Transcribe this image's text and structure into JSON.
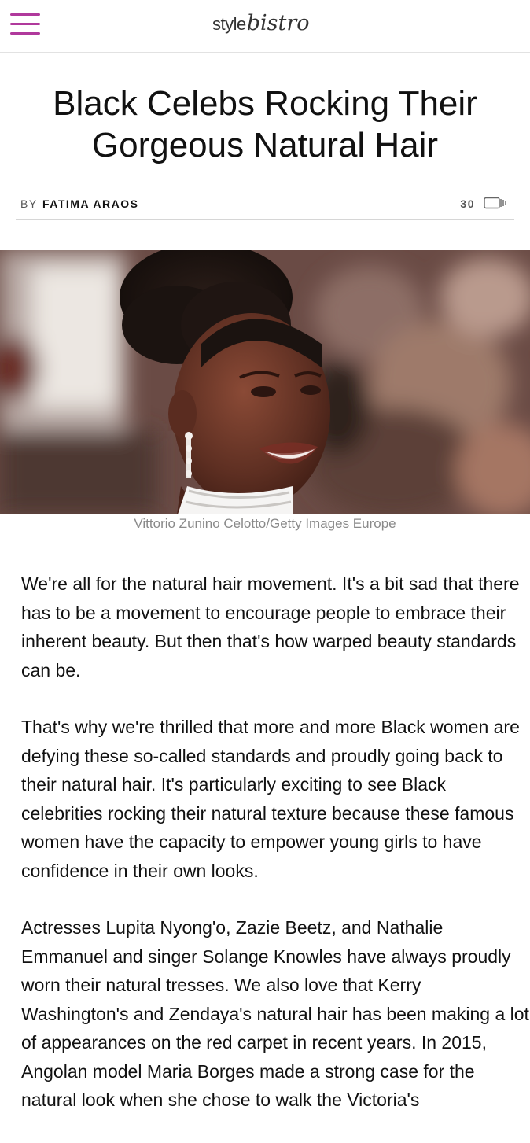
{
  "header": {
    "menu_icon": "hamburger-menu-icon",
    "logo_prefix": "style",
    "logo_script": "bistro",
    "accent_color": "#b0399c"
  },
  "article": {
    "title": "Black Celebs Rocking Their Gorgeous Natural Hair",
    "by_label": "BY",
    "author": "FATIMA ARAOS",
    "comment_count": "30",
    "comment_icon": "comment-bubble-icon",
    "image_caption": "Vittorio Zunino Celotto/Getty Images Europe",
    "paragraphs": [
      "We're all for the natural hair movement. It's a bit sad that there has to be a movement to encourage people to embrace their inherent beauty. But then that's how warped beauty standards can be.",
      "That's why we're thrilled that more and more Black women are defying these so-called standards and proudly going back to their natural hair. It's particularly exciting to see Black celebrities rocking their natural texture because these famous women have the capacity to empower young girls to have confidence in their own looks.",
      "Actresses Lupita Nyong'o, Zazie Beetz, and Nathalie Emmanuel and singer Solange Knowles have always proudly worn their natural tresses. We also love that Kerry Washington's and Zendaya's natural hair has been making a lot of appearances on the red carpet in recent years. In 2015, Angolan model Maria Borges made a strong case for the natural look when she chose to walk the Victoria's"
    ]
  }
}
